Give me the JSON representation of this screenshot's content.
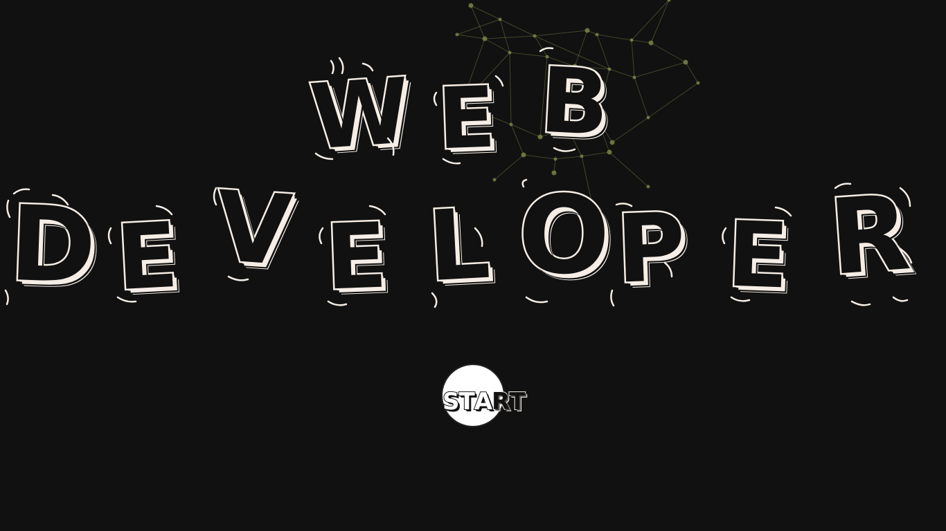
{
  "hero": {
    "line1": [
      "W",
      "E",
      "B"
    ],
    "line2": [
      "D",
      "E",
      "V",
      "E",
      "L",
      "O",
      "P",
      "E",
      "R"
    ]
  },
  "start_button": {
    "letters": [
      "S",
      "T",
      "A",
      "R",
      "T"
    ]
  },
  "colors": {
    "background": "#111111",
    "letter_outline": "#f6eee6",
    "network_lines": "#7d8a4a",
    "button_fill": "#ffffff"
  }
}
